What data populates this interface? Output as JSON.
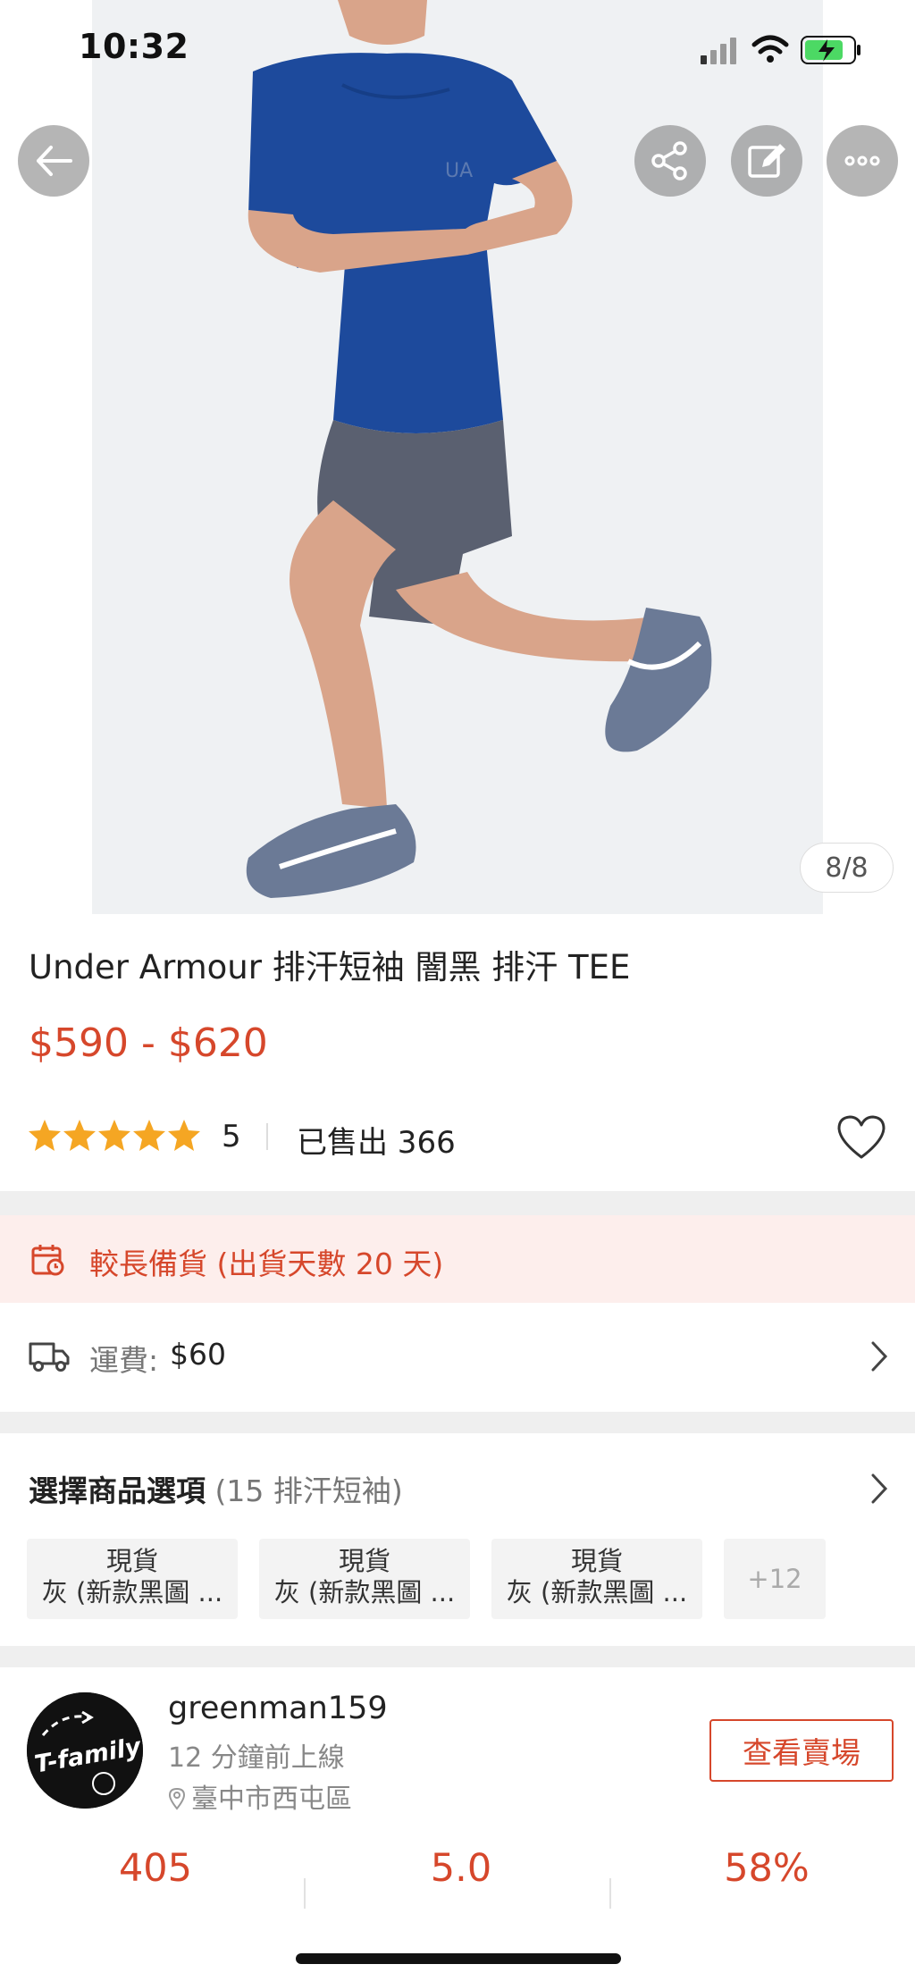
{
  "status_bar": {
    "time": "10:32"
  },
  "gallery": {
    "counter": "8/8"
  },
  "product": {
    "title": "Under Armour 排汗短袖 闇黑  排汗 TEE",
    "price": "$590 - $620",
    "rating": "5",
    "sold": "已售出 366"
  },
  "notice": {
    "text": "較長備貨 (出貨天數 20 天)"
  },
  "shipping": {
    "label": "運費:",
    "value": "$60"
  },
  "options": {
    "title": "選擇商品選項",
    "subtitle": "(15 排汗短袖)",
    "chips": [
      {
        "line1": "現貨",
        "line2": "灰 (新款黑圖 ..."
      },
      {
        "line1": "現貨",
        "line2": "灰 (新款黑圖 ..."
      },
      {
        "line1": "現貨",
        "line2": "灰 (新款黑圖 ..."
      }
    ],
    "more": "+12"
  },
  "shop": {
    "avatar_text": "T-family",
    "name": "greenman159",
    "online": "12 分鐘前上線",
    "location": "臺中市西屯區",
    "visit_label": "查看賣場",
    "stats": [
      "405",
      "5.0",
      "58%"
    ]
  },
  "colors": {
    "accent": "#d6472b",
    "notice_bg": "#fdeeec",
    "star": "#f5a623"
  }
}
